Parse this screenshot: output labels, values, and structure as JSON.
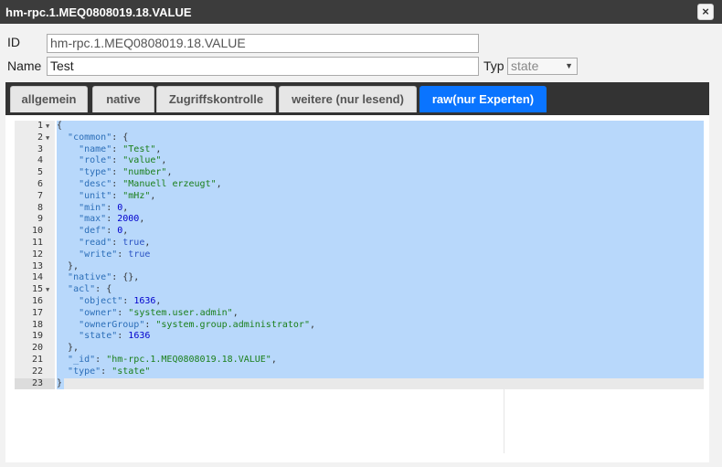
{
  "dialog": {
    "title": "hm-rpc.1.MEQ0808019.18.VALUE",
    "close_label": "×"
  },
  "form": {
    "id_label": "ID",
    "id_value": "hm-rpc.1.MEQ0808019.18.VALUE",
    "name_label": "Name",
    "name_value": "Test",
    "typ_label": "Typ",
    "typ_value": "state"
  },
  "tabs": [
    {
      "label": "allgemein",
      "active": false
    },
    {
      "label": "native",
      "active": false
    },
    {
      "label": "Zugriffskontrolle",
      "active": false
    },
    {
      "label": "weitere (nur lesend)",
      "active": false
    },
    {
      "label": "raw(nur Experten)",
      "active": true
    }
  ],
  "editor": {
    "current_line": 23,
    "lines": [
      {
        "num": "1",
        "fold": true,
        "tokens": [
          [
            "p",
            "{"
          ]
        ]
      },
      {
        "num": "2",
        "fold": true,
        "tokens": [
          [
            "p",
            "  "
          ],
          [
            "k",
            "\"common\""
          ],
          [
            "p",
            ": {"
          ]
        ]
      },
      {
        "num": "3",
        "fold": false,
        "tokens": [
          [
            "p",
            "    "
          ],
          [
            "k",
            "\"name\""
          ],
          [
            "p",
            ": "
          ],
          [
            "s",
            "\"Test\""
          ],
          [
            "p",
            ","
          ]
        ]
      },
      {
        "num": "4",
        "fold": false,
        "tokens": [
          [
            "p",
            "    "
          ],
          [
            "k",
            "\"role\""
          ],
          [
            "p",
            ": "
          ],
          [
            "s",
            "\"value\""
          ],
          [
            "p",
            ","
          ]
        ]
      },
      {
        "num": "5",
        "fold": false,
        "tokens": [
          [
            "p",
            "    "
          ],
          [
            "k",
            "\"type\""
          ],
          [
            "p",
            ": "
          ],
          [
            "s",
            "\"number\""
          ],
          [
            "p",
            ","
          ]
        ]
      },
      {
        "num": "6",
        "fold": false,
        "tokens": [
          [
            "p",
            "    "
          ],
          [
            "k",
            "\"desc\""
          ],
          [
            "p",
            ": "
          ],
          [
            "s",
            "\"Manuell erzeugt\""
          ],
          [
            "p",
            ","
          ]
        ]
      },
      {
        "num": "7",
        "fold": false,
        "tokens": [
          [
            "p",
            "    "
          ],
          [
            "k",
            "\"unit\""
          ],
          [
            "p",
            ": "
          ],
          [
            "s",
            "\"mHz\""
          ],
          [
            "p",
            ","
          ]
        ]
      },
      {
        "num": "8",
        "fold": false,
        "tokens": [
          [
            "p",
            "    "
          ],
          [
            "k",
            "\"min\""
          ],
          [
            "p",
            ": "
          ],
          [
            "n",
            "0"
          ],
          [
            "p",
            ","
          ]
        ]
      },
      {
        "num": "9",
        "fold": false,
        "tokens": [
          [
            "p",
            "    "
          ],
          [
            "k",
            "\"max\""
          ],
          [
            "p",
            ": "
          ],
          [
            "n",
            "2000"
          ],
          [
            "p",
            ","
          ]
        ]
      },
      {
        "num": "10",
        "fold": false,
        "tokens": [
          [
            "p",
            "    "
          ],
          [
            "k",
            "\"def\""
          ],
          [
            "p",
            ": "
          ],
          [
            "n",
            "0"
          ],
          [
            "p",
            ","
          ]
        ]
      },
      {
        "num": "11",
        "fold": false,
        "tokens": [
          [
            "p",
            "    "
          ],
          [
            "k",
            "\"read\""
          ],
          [
            "p",
            ": "
          ],
          [
            "b",
            "true"
          ],
          [
            "p",
            ","
          ]
        ]
      },
      {
        "num": "12",
        "fold": false,
        "tokens": [
          [
            "p",
            "    "
          ],
          [
            "k",
            "\"write\""
          ],
          [
            "p",
            ": "
          ],
          [
            "b",
            "true"
          ]
        ]
      },
      {
        "num": "13",
        "fold": false,
        "tokens": [
          [
            "p",
            "  },"
          ]
        ]
      },
      {
        "num": "14",
        "fold": false,
        "tokens": [
          [
            "p",
            "  "
          ],
          [
            "k",
            "\"native\""
          ],
          [
            "p",
            ": {},"
          ]
        ]
      },
      {
        "num": "15",
        "fold": true,
        "tokens": [
          [
            "p",
            "  "
          ],
          [
            "k",
            "\"acl\""
          ],
          [
            "p",
            ": {"
          ]
        ]
      },
      {
        "num": "16",
        "fold": false,
        "tokens": [
          [
            "p",
            "    "
          ],
          [
            "k",
            "\"object\""
          ],
          [
            "p",
            ": "
          ],
          [
            "n",
            "1636"
          ],
          [
            "p",
            ","
          ]
        ]
      },
      {
        "num": "17",
        "fold": false,
        "tokens": [
          [
            "p",
            "    "
          ],
          [
            "k",
            "\"owner\""
          ],
          [
            "p",
            ": "
          ],
          [
            "s",
            "\"system.user.admin\""
          ],
          [
            "p",
            ","
          ]
        ]
      },
      {
        "num": "18",
        "fold": false,
        "tokens": [
          [
            "p",
            "    "
          ],
          [
            "k",
            "\"ownerGroup\""
          ],
          [
            "p",
            ": "
          ],
          [
            "s",
            "\"system.group.administrator\""
          ],
          [
            "p",
            ","
          ]
        ]
      },
      {
        "num": "19",
        "fold": false,
        "tokens": [
          [
            "p",
            "    "
          ],
          [
            "k",
            "\"state\""
          ],
          [
            "p",
            ": "
          ],
          [
            "n",
            "1636"
          ]
        ]
      },
      {
        "num": "20",
        "fold": false,
        "tokens": [
          [
            "p",
            "  },"
          ]
        ]
      },
      {
        "num": "21",
        "fold": false,
        "tokens": [
          [
            "p",
            "  "
          ],
          [
            "k",
            "\"_id\""
          ],
          [
            "p",
            ": "
          ],
          [
            "s",
            "\"hm-rpc.1.MEQ0808019.18.VALUE\""
          ],
          [
            "p",
            ","
          ]
        ]
      },
      {
        "num": "22",
        "fold": false,
        "tokens": [
          [
            "p",
            "  "
          ],
          [
            "k",
            "\"type\""
          ],
          [
            "p",
            ": "
          ],
          [
            "s",
            "\"state\""
          ]
        ]
      },
      {
        "num": "23",
        "fold": false,
        "tokens": [
          [
            "p",
            "}"
          ]
        ]
      }
    ]
  },
  "colors": {
    "titlebar": "#3c3c3c",
    "tab_active": "#0a74ff",
    "selection": "#b8d8fb",
    "json_key": "#2b6eb8",
    "json_string": "#1a7f1a",
    "json_number": "#0000cd",
    "json_boolean": "#2a53c4"
  },
  "icons": {
    "close": "close-icon",
    "fold": "fold-arrow-icon",
    "dropdown": "chevron-down-icon"
  }
}
